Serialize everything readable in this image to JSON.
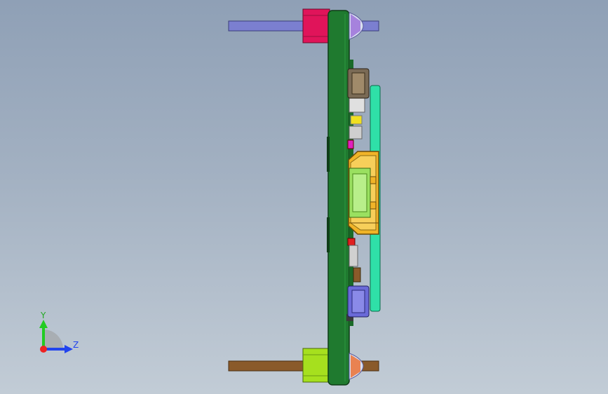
{
  "scene": {
    "colors": {
      "background_top": "#8fa0b6",
      "background_bottom": "#c2ccd6",
      "board": "#1f7a2f",
      "board_edge": "#0f3d17",
      "shaft_top": "#7b7fd0",
      "shaft_bottom": "#8a5a2a",
      "standoff_top": "#e0145a",
      "standoff_bottom": "#a6e01e",
      "daughter_board": "#2fe0a8",
      "connector_frame": "#f0b428",
      "connector_body": "#9ae060",
      "nut_top": "#7a6a55",
      "nut_bottom": "#6a6ad8",
      "component_dark": "#3a3a3a"
    },
    "parts": [
      "top-shaft",
      "top-standoff",
      "main-board",
      "top-clip",
      "top-nut",
      "daughter-board",
      "usb-connector",
      "bottom-nut",
      "bottom-clip",
      "bottom-standoff",
      "bottom-shaft"
    ]
  },
  "triad": {
    "y_label": "Y",
    "z_label": "Z",
    "colors": {
      "y": "#22cc22",
      "z": "#2244ee",
      "x": "#ee2222"
    }
  }
}
